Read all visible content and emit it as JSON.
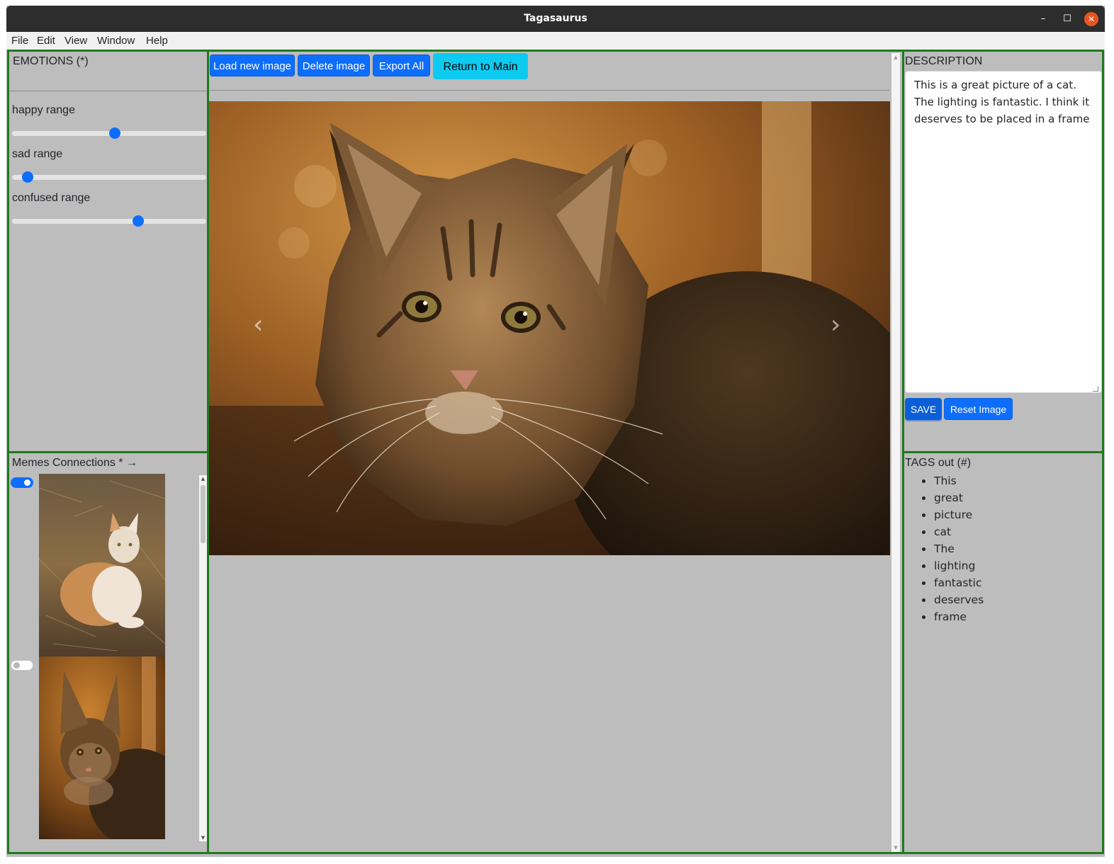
{
  "window": {
    "title": "Tagasaurus",
    "minimize_glyph": "–",
    "maximize_glyph": "☐",
    "close_glyph": "✕"
  },
  "menu": {
    "items": [
      {
        "label": "File"
      },
      {
        "label": "Edit"
      },
      {
        "label": "View"
      },
      {
        "label": "Window"
      },
      {
        "label": "Help"
      }
    ]
  },
  "emotions": {
    "heading": "EMOTIONS (*)",
    "ranges": [
      {
        "label": "happy range",
        "value": 53
      },
      {
        "label": "sad range",
        "value": 8
      },
      {
        "label": "confused range",
        "value": 65
      }
    ]
  },
  "memes": {
    "heading": "Memes Connections * →",
    "items": [
      {
        "enabled": true,
        "image": "white-and-orange-cat-on-straw"
      },
      {
        "enabled": false,
        "image": "tabby-kitten"
      }
    ]
  },
  "toolbar": {
    "load_label": "Load new image",
    "delete_label": "Delete image",
    "export_label": "Export All",
    "return_label": "Return to Main"
  },
  "main_image": {
    "subject": "tabby-kitten",
    "prev_glyph": "‹",
    "next_glyph": "›"
  },
  "description": {
    "heading": "DESCRIPTION",
    "text": "This is a great picture of a cat. The lighting is fantastic. I think it deserves to be placed in a frame",
    "save_label": "SAVE",
    "reset_label": "Reset Image"
  },
  "tags": {
    "heading": "TAGS out (#)",
    "items": [
      "This",
      "great",
      "picture",
      "cat",
      "The",
      "lighting",
      "fantastic",
      "deserves",
      "frame"
    ]
  },
  "colors": {
    "panel_border": "#1e7a1e",
    "primary": "#0d6efd",
    "info": "#0dcaf0",
    "close_button": "#e95420"
  }
}
